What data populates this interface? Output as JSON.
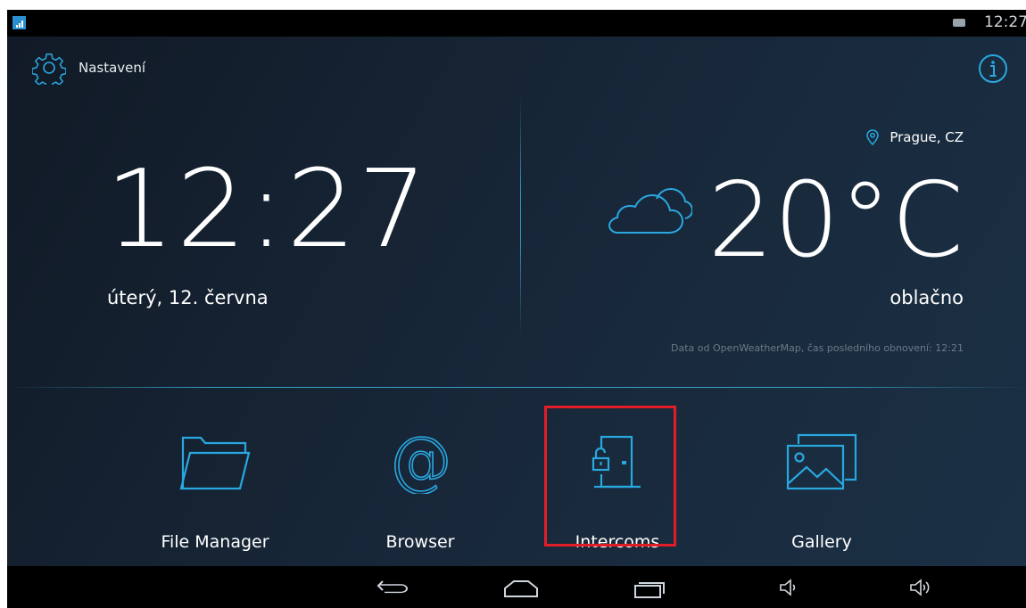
{
  "statusbar": {
    "time": "12:27"
  },
  "header": {
    "settings_label": "Nastavení"
  },
  "clock": {
    "time": "12:27",
    "date": "úterý, 12. června"
  },
  "weather": {
    "location": "Prague, CZ",
    "temperature": "20°C",
    "description": "oblačno",
    "source_note": "Data od OpenWeatherMap, čas posledního obnovení: 12:21"
  },
  "apps": [
    {
      "label": "File Manager",
      "icon": "folder-icon"
    },
    {
      "label": "Browser",
      "icon": "at-sign-icon"
    },
    {
      "label": "Intercoms",
      "icon": "door-lock-icon",
      "highlighted": true
    },
    {
      "label": "Gallery",
      "icon": "gallery-icon"
    }
  ],
  "colors": {
    "accent": "#29a8e0",
    "highlight": "#e21d26"
  },
  "navbar": [
    "back-icon",
    "home-icon",
    "recent-apps-icon",
    "volume-down-icon",
    "volume-up-icon"
  ]
}
